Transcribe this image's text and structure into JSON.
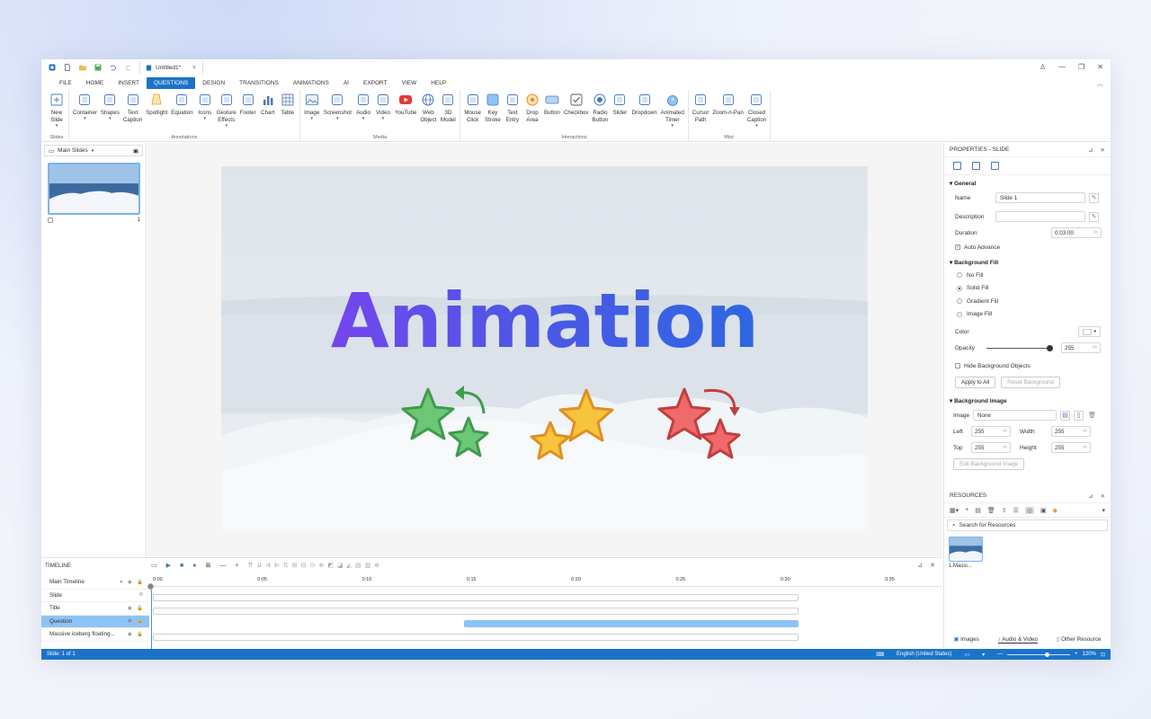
{
  "document": {
    "tab_title": "Untitled1*"
  },
  "menu": {
    "items": [
      "FILE",
      "HOME",
      "INSERT",
      "QUESTIONS",
      "DESIGN",
      "TRANSITIONS",
      "ANIMATIONS",
      "AI",
      "EXPORT",
      "VIEW",
      "HELP"
    ],
    "active": "QUESTIONS"
  },
  "ribbon": {
    "groups": [
      {
        "label": "Slides",
        "buttons": [
          {
            "label": "New\nSlide",
            "icon": "new-slide-icon",
            "dd": true
          }
        ]
      },
      {
        "label": "Annotations",
        "buttons": [
          {
            "label": "Container",
            "icon": "container-icon",
            "dd": true
          },
          {
            "label": "Shapes",
            "icon": "shapes-icon",
            "dd": true
          },
          {
            "label": "Text\nCaption",
            "icon": "text-caption-icon",
            "dd": false
          },
          {
            "label": "Spotlight",
            "icon": "spotlight-icon",
            "dd": false
          },
          {
            "label": "Equation",
            "icon": "equation-icon",
            "dd": false
          },
          {
            "label": "Icons",
            "icon": "icons-icon",
            "dd": true
          },
          {
            "label": "Gesture\nEffects",
            "icon": "gesture-icon",
            "dd": true
          },
          {
            "label": "Footer",
            "icon": "footer-icon",
            "dd": false
          },
          {
            "label": "Chart",
            "icon": "chart-icon",
            "dd": false
          },
          {
            "label": "Table",
            "icon": "table-icon",
            "dd": false
          }
        ]
      },
      {
        "label": "Media",
        "buttons": [
          {
            "label": "Image",
            "icon": "image-icon",
            "dd": true
          },
          {
            "label": "Screenshot",
            "icon": "screenshot-icon",
            "dd": true
          },
          {
            "label": "Audio",
            "icon": "audio-icon",
            "dd": true
          },
          {
            "label": "Video",
            "icon": "video-icon",
            "dd": true
          },
          {
            "label": "YouTube",
            "icon": "youtube-icon",
            "dd": false
          },
          {
            "label": "Web\nObject",
            "icon": "web-object-icon",
            "dd": false
          },
          {
            "label": "3D\nModel",
            "icon": "3d-model-icon",
            "dd": false
          }
        ]
      },
      {
        "label": "Interactions",
        "buttons": [
          {
            "label": "Mouse\nClick",
            "icon": "mouse-icon",
            "dd": false
          },
          {
            "label": "Key\nStroke",
            "icon": "key-icon",
            "dd": false
          },
          {
            "label": "Text\nEntry",
            "icon": "text-entry-icon",
            "dd": false
          },
          {
            "label": "Drop\nArea",
            "icon": "drop-area-icon",
            "dd": false
          },
          {
            "label": "Button",
            "icon": "button-icon",
            "dd": false
          },
          {
            "label": "Checkbox",
            "icon": "checkbox-icon",
            "dd": false
          },
          {
            "label": "Radio\nButton",
            "icon": "radio-icon",
            "dd": false
          },
          {
            "label": "Slider",
            "icon": "slider-icon",
            "dd": false
          },
          {
            "label": "Dropdown",
            "icon": "dropdown-icon",
            "dd": false
          },
          {
            "label": "Animated\nTimer",
            "icon": "timer-icon",
            "dd": true
          }
        ]
      },
      {
        "label": "Misc",
        "buttons": [
          {
            "label": "Cursor\nPath",
            "icon": "cursor-path-icon",
            "dd": false
          },
          {
            "label": "Zoom-n-Pan",
            "icon": "zoom-pan-icon",
            "dd": false
          },
          {
            "label": "Closed\nCaption",
            "icon": "cc-icon",
            "dd": true
          }
        ]
      }
    ]
  },
  "slides_panel": {
    "header": "Main Slides",
    "slide_number": "1"
  },
  "slide": {
    "title": "Animation"
  },
  "properties": {
    "title": "PROPERTIES - SLIDE",
    "general": {
      "heading": "General",
      "name_label": "Name",
      "name_value": "Slide 1",
      "description_label": "Description",
      "description_value": "",
      "duration_label": "Duration",
      "duration_value": "0:03:00",
      "auto_advance": "Auto Advance"
    },
    "fill": {
      "heading": "Background Fill",
      "options": [
        "No Fill",
        "Solid Fill",
        "Gradient Fill",
        "Image Fill"
      ],
      "selected": 1,
      "color_label": "Color",
      "opacity_label": "Opacity",
      "opacity_value": "255",
      "hide_bg": "Hide Background Objects",
      "apply_all": "Apply to All",
      "reset_bg": "Reset Background"
    },
    "bg_image": {
      "heading": "Background Image",
      "image_label": "Image",
      "image_value": "None",
      "left_label": "Left",
      "left_value": "255",
      "width_label": "Width",
      "width_value": "255",
      "top_label": "Top",
      "top_value": "255",
      "height_label": "Height",
      "height_value": "255",
      "edit_btn": "Edit Background Image"
    }
  },
  "resources": {
    "title": "RESOURCES",
    "search_placeholder": "Search for Resources",
    "item_label": "1.Massi...",
    "tabs": [
      "Images",
      "Audio & Video",
      "Other Resource"
    ]
  },
  "timeline": {
    "title": "TIMELINE",
    "rows": [
      "Main Timeline",
      "Slide",
      "Title",
      "Question",
      "Massive iceberg floating..."
    ],
    "selected_row": 3,
    "ticks": [
      "0:00",
      "0:05",
      "0:10",
      "0:15",
      "0:20",
      "0:25",
      "0:30",
      "0:35"
    ]
  },
  "status": {
    "slide": "Slide: 1 of 1",
    "language": "English (United States)",
    "zoom": "120%"
  },
  "colors": {
    "accent": "#1b73c9",
    "title_start": "#8b3cf2",
    "title_end": "#1f6fe0",
    "star_green": "#5cc06a",
    "star_orange": "#f7c43d",
    "star_red": "#ef6b6b"
  }
}
